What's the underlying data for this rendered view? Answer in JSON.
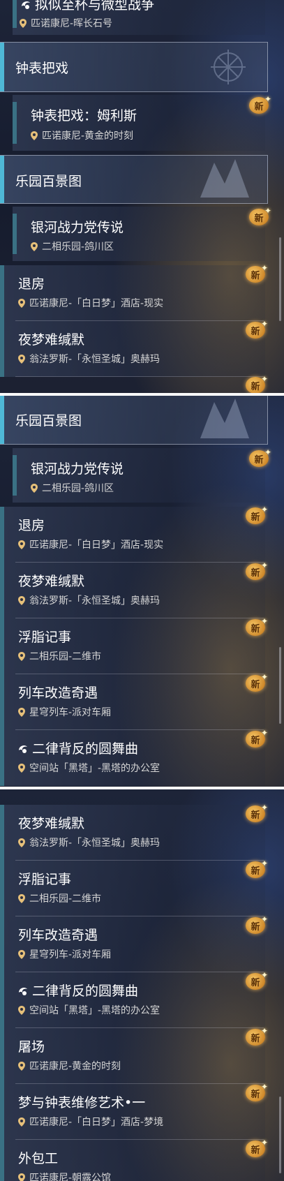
{
  "badge_label": "新",
  "headers": {
    "clock": "钟表把戏",
    "park": "乐园百景图"
  },
  "missions": {
    "wargame": {
      "title": "拟似至杯与微型战争",
      "location": "匹诺康尼-晖长石号"
    },
    "mulius": {
      "title": "钟表把戏：姆利斯",
      "location": "匹诺康尼-黄金的时刻"
    },
    "galaxy": {
      "title": "银河战力党传说",
      "location": "二相乐园-鸽川区"
    },
    "checkout": {
      "title": "退房",
      "location": "匹诺康尼-「白日梦」酒店-现实"
    },
    "nightmare": {
      "title": "夜梦难缄默",
      "location": "翁法罗斯-「永恒圣城」奥赫玛"
    },
    "fat": {
      "title": "浮脂记事",
      "location": "二相乐园-二维市"
    },
    "train": {
      "title": "列车改造奇遇",
      "location": "星穹列车-派对车厢"
    },
    "rondo": {
      "title": "二律背反的圆舞曲",
      "location": "空间站「黑塔」-黑塔的办公室"
    },
    "slaughter": {
      "title": "屠场",
      "location": "匹诺康尼-黄金的时刻"
    },
    "dream": {
      "title": "梦与钟表维修艺术•一",
      "location": "匹诺康尼-「白日梦」酒店-梦境"
    },
    "outsource": {
      "title": "外包工",
      "location": "匹诺康尼-朝露公馆"
    }
  },
  "colors": {
    "accent_teal": "#3a7184",
    "header_accent": "#4fb8d6",
    "badge_gold": "#f6c766",
    "separator": "#fafafa"
  },
  "icons": {
    "location": "map-pin-icon",
    "new": "new-badge-icon",
    "mission_type": "swirl-mission-icon"
  }
}
